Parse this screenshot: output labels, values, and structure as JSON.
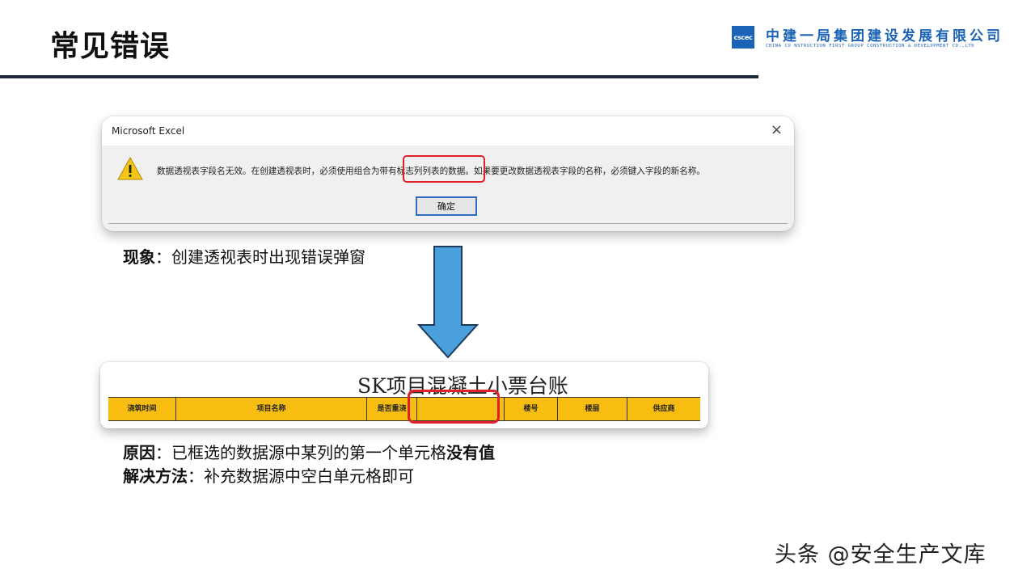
{
  "slide": {
    "title": "常见错误"
  },
  "logo": {
    "mark": "cscec",
    "company_cn": "中建一局集团建设发展有限公司",
    "company_en": "CHINA CO NSTRUCTION FIRST GROUP CONSTRUCTION & DEVELOPMENT CO.,LTD"
  },
  "dialog": {
    "title": "Microsoft Excel",
    "close_glyph": "×",
    "message": "数据透视表字段名无效。在创建透视表时，必须使用组合为带有标志列列表的数据。如果要更改数据透视表字段的名称，必须键入字段的新名称。",
    "ok_label": "确定",
    "icon": "warning-icon"
  },
  "phenomenon": {
    "label": "现象",
    "text": "：创建透视表时出现错误弹窗"
  },
  "table": {
    "title": "SK项目混凝土小票台账",
    "headers": [
      "浇筑时间",
      "项目名称",
      "是否重浇",
      "",
      "楼号",
      "楼层",
      "供应商"
    ],
    "highlight_color": "#e0202a",
    "header_color": "#f7bd10"
  },
  "cause": {
    "label": "原因",
    "text": "：已框选的数据源中某列的第一个单元格",
    "emphasis": "没有值"
  },
  "solution": {
    "label": "解决方法",
    "text": "：补充数据源中空白单元格即可"
  },
  "watermark": "头条 @安全生产文库",
  "colors": {
    "arrow": "#4a9fdd",
    "rule": "#1d2a3a",
    "brand": "#1b63b6"
  }
}
